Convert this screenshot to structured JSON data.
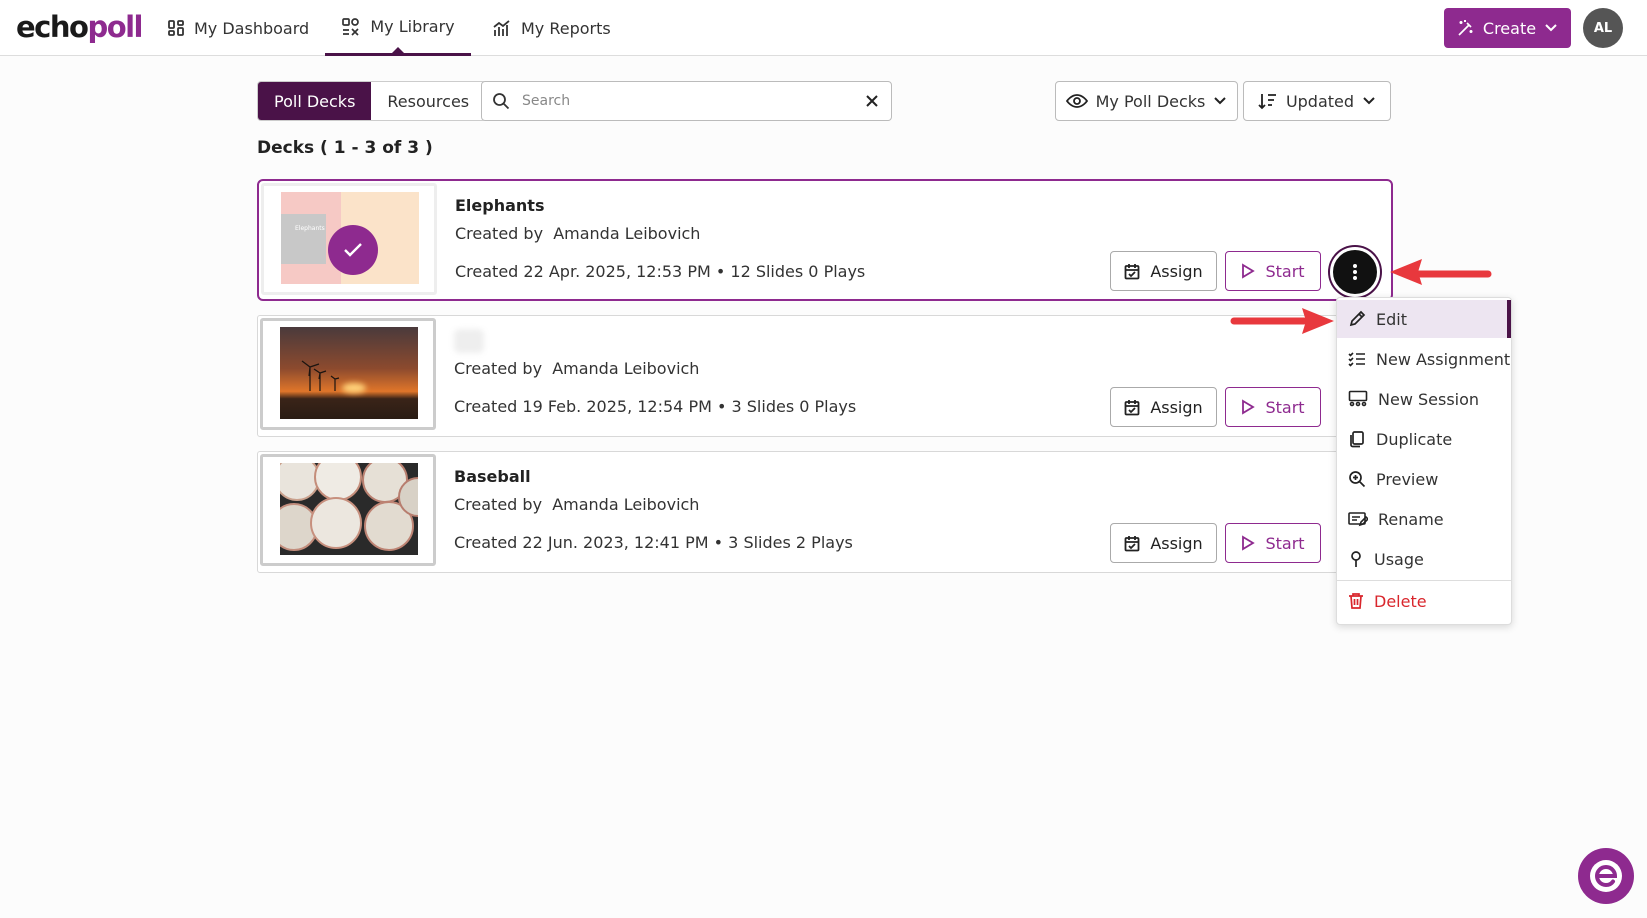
{
  "logo": {
    "part1": "echo",
    "part2": "poll"
  },
  "nav": {
    "dashboard": "My Dashboard",
    "library": "My Library",
    "reports": "My Reports"
  },
  "header": {
    "create_label": "Create",
    "avatar_initials": "AL"
  },
  "toolbar": {
    "tab_poll_decks": "Poll Decks",
    "tab_resources": "Resources",
    "search_placeholder": "Search",
    "filter_label": "My Poll Decks",
    "sort_label": "Updated"
  },
  "decks_count": "Decks ( 1 - 3 of 3 )",
  "decks": [
    {
      "title": "Elephants",
      "creator": "Created by  Amanda Leibovich",
      "meta": "Created 22 Apr. 2025, 12:53 PM • 12 Slides 0 Plays",
      "thumb_text": "Elephants"
    },
    {
      "title": "",
      "creator": "Created by  Amanda Leibovich",
      "meta": "Created 19 Feb. 2025, 12:54 PM • 3 Slides 0 Plays"
    },
    {
      "title": "Baseball",
      "creator": "Created by  Amanda Leibovich",
      "meta": "Created 22 Jun. 2023, 12:41 PM • 3 Slides 2 Plays"
    }
  ],
  "buttons": {
    "assign": "Assign",
    "start": "Start"
  },
  "context_menu": {
    "items": [
      "Edit",
      "New Assignment",
      "New Session",
      "Duplicate",
      "Preview",
      "Rename",
      "Usage",
      "Delete"
    ]
  },
  "colors": {
    "brand": "#8e2a8f",
    "dark_brand": "#4a1248",
    "danger": "#d9262c",
    "annotation_arrow": "#e8383d"
  }
}
